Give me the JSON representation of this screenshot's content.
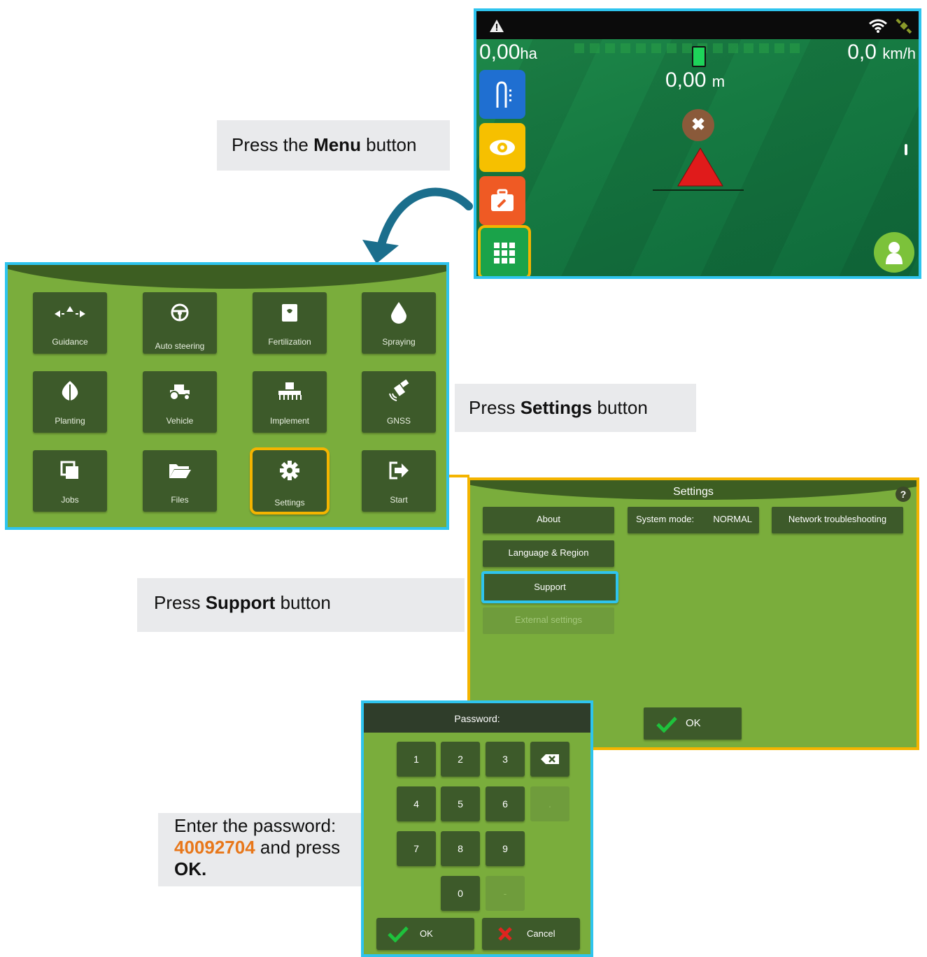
{
  "callouts": {
    "menu": {
      "pre": "Press the ",
      "bold": "Menu",
      "post": " button"
    },
    "settings": {
      "pre": "Press ",
      "bold": "Settings",
      "post": " button"
    },
    "support": {
      "pre": "Press ",
      "bold": "Support",
      "post": " button"
    },
    "password": {
      "line1": "Enter the password:",
      "code": "40092704",
      "mid": " and press",
      "ok": "OK."
    }
  },
  "guidance_screen": {
    "area_value": "0,00",
    "area_unit": "ha",
    "speed_value": "0,0",
    "speed_unit": "km/h",
    "distance_value": "0,00",
    "distance_unit": "m",
    "side_buttons": [
      {
        "name": "guidance-lines-button",
        "color": "#1f6fd1",
        "icon": "u-turn-icon"
      },
      {
        "name": "view-button",
        "color": "#f6c000",
        "icon": "eye-icon"
      },
      {
        "name": "tools-button",
        "color": "#ef5a24",
        "icon": "toolbox-icon"
      },
      {
        "name": "menu-button",
        "color": "#1aa34a",
        "icon": "grid-icon"
      }
    ],
    "colors": {
      "highlight": "#f4b400",
      "frame": "#2ec4ee",
      "marker": "#e01b1b",
      "user": "#7cc23a"
    }
  },
  "main_menu": {
    "tiles": [
      {
        "label": "Guidance",
        "icon": "guidance-arrows-icon"
      },
      {
        "label": "Auto steering",
        "icon": "steering-wheel-icon"
      },
      {
        "label": "Fertilization",
        "icon": "fertilizer-bag-icon"
      },
      {
        "label": "Spraying",
        "icon": "droplet-icon"
      },
      {
        "label": "Planting",
        "icon": "leaf-icon"
      },
      {
        "label": "Vehicle",
        "icon": "tractor-icon"
      },
      {
        "label": "Implement",
        "icon": "implement-icon"
      },
      {
        "label": "GNSS",
        "icon": "satellite-icon"
      },
      {
        "label": "Jobs",
        "icon": "jobs-icon"
      },
      {
        "label": "Files",
        "icon": "folder-icon"
      },
      {
        "label": "Settings",
        "icon": "gear-icon"
      },
      {
        "label": "Start",
        "icon": "exit-icon"
      }
    ]
  },
  "settings_screen": {
    "title": "Settings",
    "help": "?",
    "about": "About",
    "system_mode_label": "System mode:",
    "system_mode_value": "NORMAL",
    "network": "Network troubleshooting",
    "language": "Language & Region",
    "support": "Support",
    "external": "External settings",
    "ok": "OK"
  },
  "password_dialog": {
    "title": "Password:",
    "keys": [
      "1",
      "2",
      "3",
      "4",
      "5",
      "6",
      "7",
      "8",
      "9",
      "0"
    ],
    "dot": ".",
    "minus": "-",
    "ok": "OK",
    "cancel": "Cancel"
  }
}
